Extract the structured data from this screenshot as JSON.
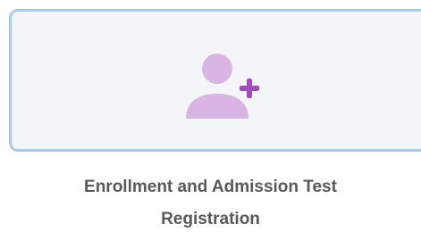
{
  "card": {
    "icon": "add-user-icon",
    "caption_line1": "Enrollment and Admission Test",
    "caption_line2": "Registration"
  },
  "colors": {
    "tile_background": "#f4f5f9",
    "tile_border": "#aac9f1",
    "icon_person": "#d8b5e3",
    "icon_plus": "#a34cc0",
    "caption_text": "#595959"
  }
}
